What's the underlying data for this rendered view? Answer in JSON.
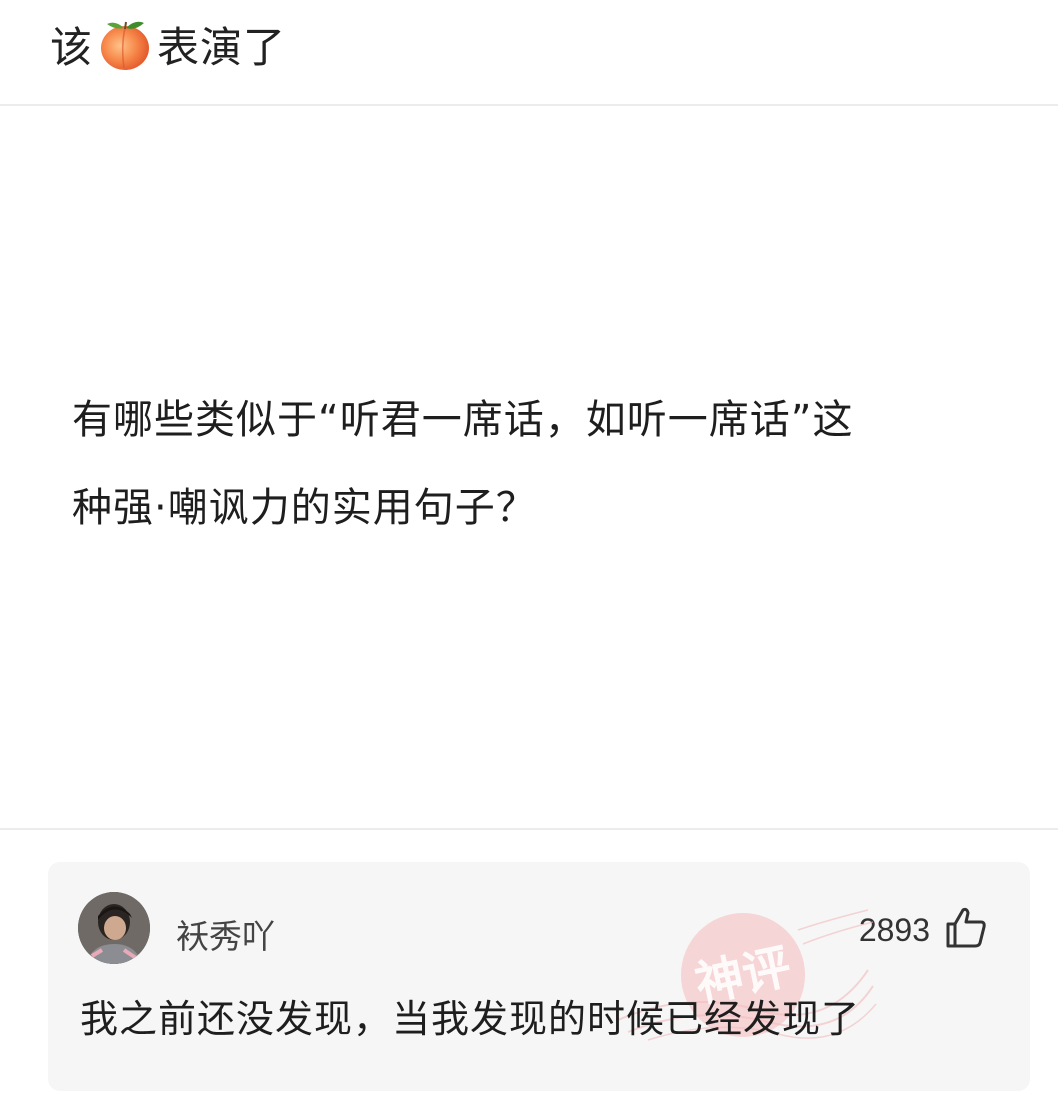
{
  "header": {
    "title_before": "该",
    "title_emoji": "peach-emoji",
    "title_after": "表演了"
  },
  "question": {
    "line1": "有哪些类似于“听君一席话，如听一席话”这",
    "line2": "种强·嘲讽力的实用句子？"
  },
  "comment": {
    "avatar": "user-avatar",
    "username": "袄秀吖",
    "like_count": "2893",
    "like_icon": "thumbs-up-icon",
    "text": "我之前还没发现，当我发现的时候已经发现了",
    "stamp_label": "神评",
    "stamp_color": "#f2a2a6"
  },
  "colors": {
    "background": "#ffffff",
    "divider": "#ececec",
    "comment_background": "#f6f6f6",
    "text": "#1e1e1e"
  }
}
